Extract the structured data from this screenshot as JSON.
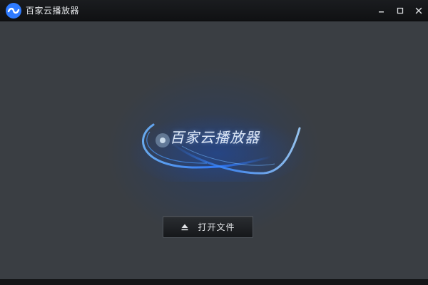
{
  "window": {
    "title": "百家云播放器",
    "icons": {
      "logo": "baijiayun-logo-icon",
      "minimize": "minimize-icon",
      "maximize": "maximize-icon",
      "close": "close-icon"
    }
  },
  "splash": {
    "title": "百家云播放器",
    "accent_color": "#2f7bff"
  },
  "open_file_button": {
    "label": "打开文件",
    "icon": "eject-icon"
  },
  "colors": {
    "background": "#3a3e43",
    "titlebar": "#15171a",
    "accent": "#2f7bff"
  }
}
